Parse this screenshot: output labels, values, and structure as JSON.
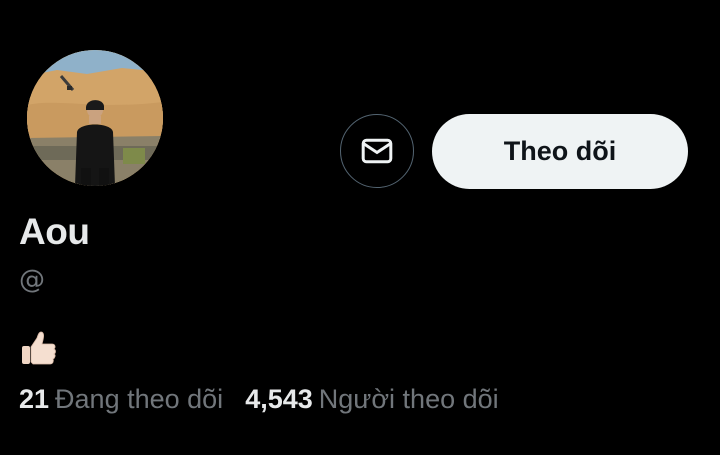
{
  "profile": {
    "display_name": "Aou",
    "handle": "@",
    "bio_emoji": "👍🏻",
    "avatar_alt": "avatar photo"
  },
  "actions": {
    "message_icon": "envelope-icon",
    "follow_label": "Theo dõi"
  },
  "stats": {
    "following_count": "21",
    "following_label": "Đang theo dõi",
    "followers_count": "4,543",
    "followers_label": "Người theo dõi"
  },
  "colors": {
    "background": "#000000",
    "primary_text": "#e7e9ea",
    "secondary_text": "#71767b",
    "follow_button_bg": "#eff3f4",
    "follow_button_text": "#0f1419",
    "border": "#536471"
  }
}
